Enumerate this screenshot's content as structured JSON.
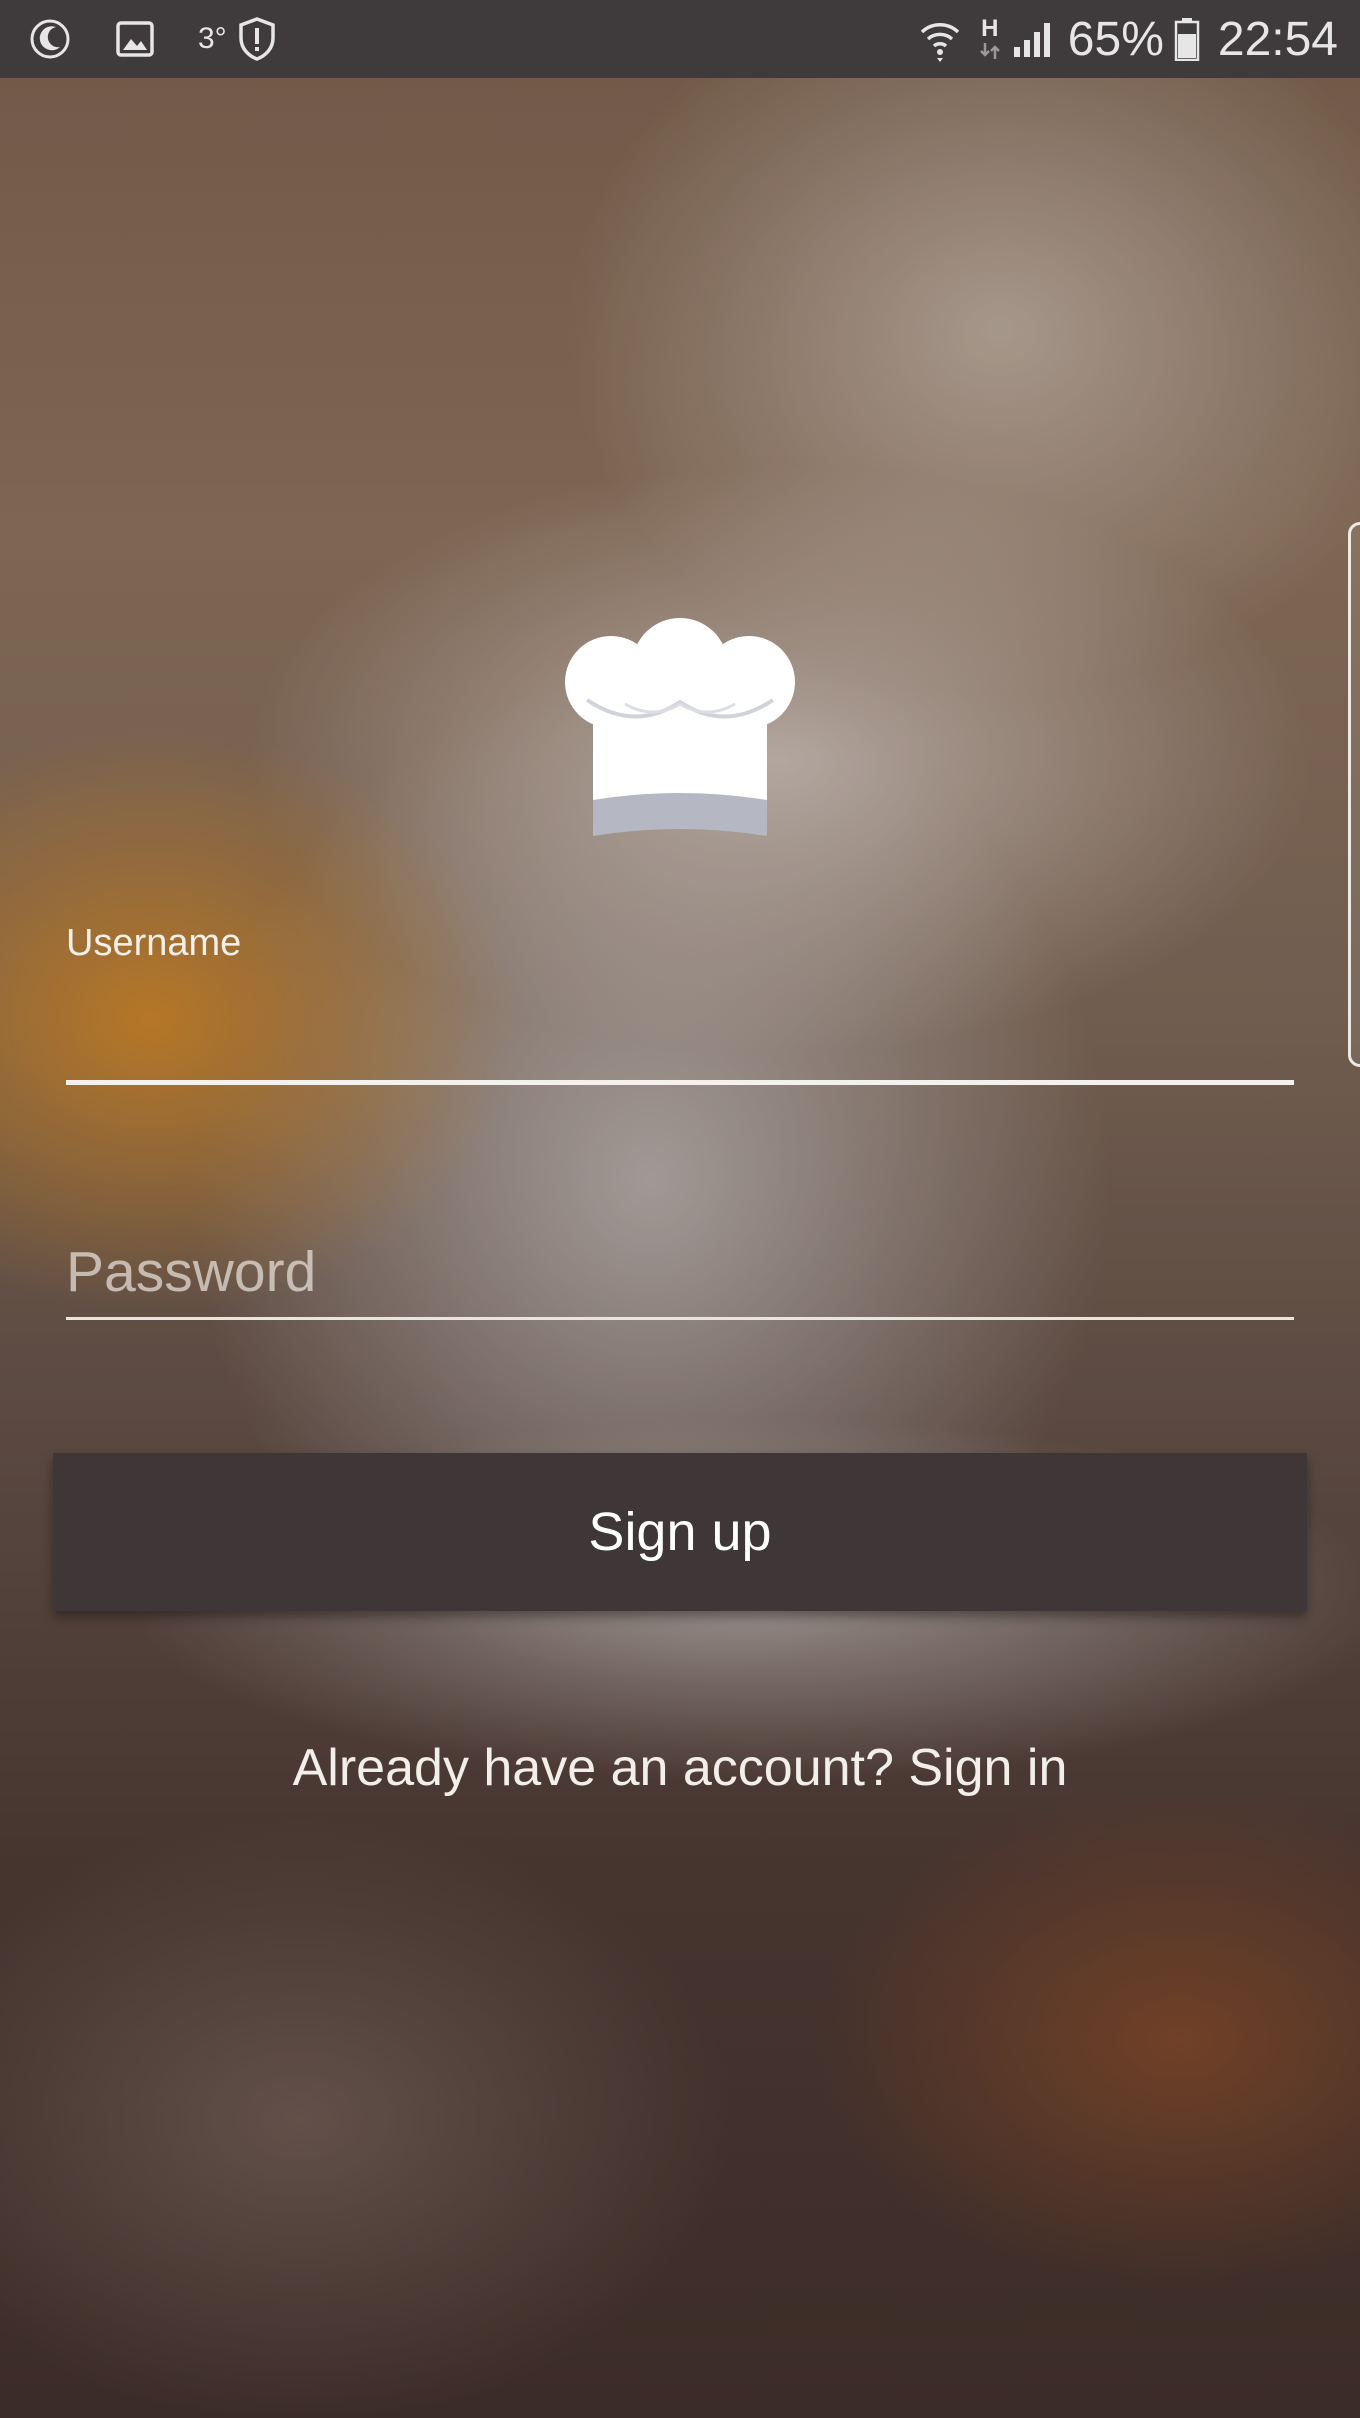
{
  "status_bar": {
    "left_icons": [
      "moon-icon",
      "image-icon",
      "temperature-icon",
      "shield-alert-icon"
    ],
    "temperature": "3°",
    "right_icons": [
      "wifi-icon",
      "h-network-icon",
      "signal-icon",
      "battery-icon"
    ],
    "network_type": "H",
    "battery_percent": "65%",
    "time": "22:54"
  },
  "logo": {
    "icon": "chef-hat-icon"
  },
  "form": {
    "username_label": "Username",
    "username_value": "",
    "password_placeholder": "Password",
    "password_value": ""
  },
  "actions": {
    "signup_label": "Sign up",
    "signin_link": "Already have an account? Sign in"
  },
  "colors": {
    "status_bar": "#3f3a3b",
    "button_bg": "#3e3637",
    "text_light": "#f3efe9"
  }
}
